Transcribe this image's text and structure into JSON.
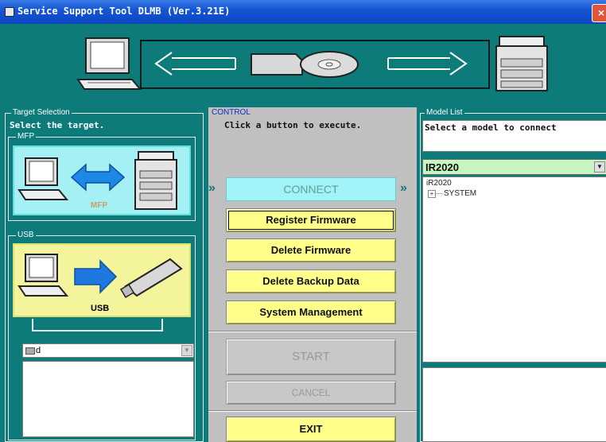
{
  "window": {
    "title": "Service Support Tool DLMB (Ver.3.21E)",
    "close_label": "×"
  },
  "target": {
    "section_label": "Target Selection",
    "instruction": "Select the target.",
    "mfp_group_label": "MFP",
    "mfp_caption": "MFP",
    "usb_group_label": "USB",
    "usb_caption": "USB",
    "drive_value": "d"
  },
  "control": {
    "section_label": "CONTROL",
    "instruction": "Click a button to execute.",
    "connect": "CONNECT",
    "buttons": {
      "register_firmware": "Register Firmware",
      "delete_firmware": "Delete Firmware",
      "delete_backup": "Delete Backup Data",
      "system_management": "System Management",
      "start": "START",
      "cancel": "CANCEL",
      "exit": "EXIT"
    },
    "arrow_glyph": "»"
  },
  "model": {
    "section_label": "Model List",
    "instruction": "Select a model to connect",
    "selected_model": "IR2020",
    "tree_root": "iR2020",
    "tree_child": "SYSTEM",
    "expand_glyph": "+"
  },
  "colors": {
    "teal": "#0e7b7b",
    "button_yellow": "#ffff8a",
    "connect_cyan": "#a0f4f8",
    "selected_green": "#c8f6c0"
  }
}
